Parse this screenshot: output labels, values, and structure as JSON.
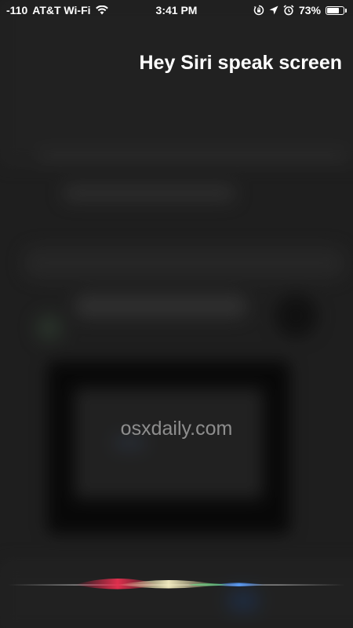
{
  "status_bar": {
    "signal": "-110",
    "carrier": "AT&T Wi-Fi",
    "time": "3:41 PM",
    "battery_percent": "73%",
    "battery_level": 0.73,
    "icons": [
      "wifi-icon",
      "orientation-lock-icon",
      "location-arrow-icon",
      "alarm-icon",
      "battery-icon"
    ]
  },
  "siri": {
    "query": "Hey Siri speak screen"
  },
  "watermark": "osxdaily.com",
  "colors": {
    "background": "#222222",
    "text": "#ffffff",
    "watermark": "#8e8e8e",
    "wave_red": "#d8264a",
    "wave_yellow": "#f3e6a8",
    "wave_blue": "#3b82f6",
    "wave_green": "#5ad17a"
  }
}
